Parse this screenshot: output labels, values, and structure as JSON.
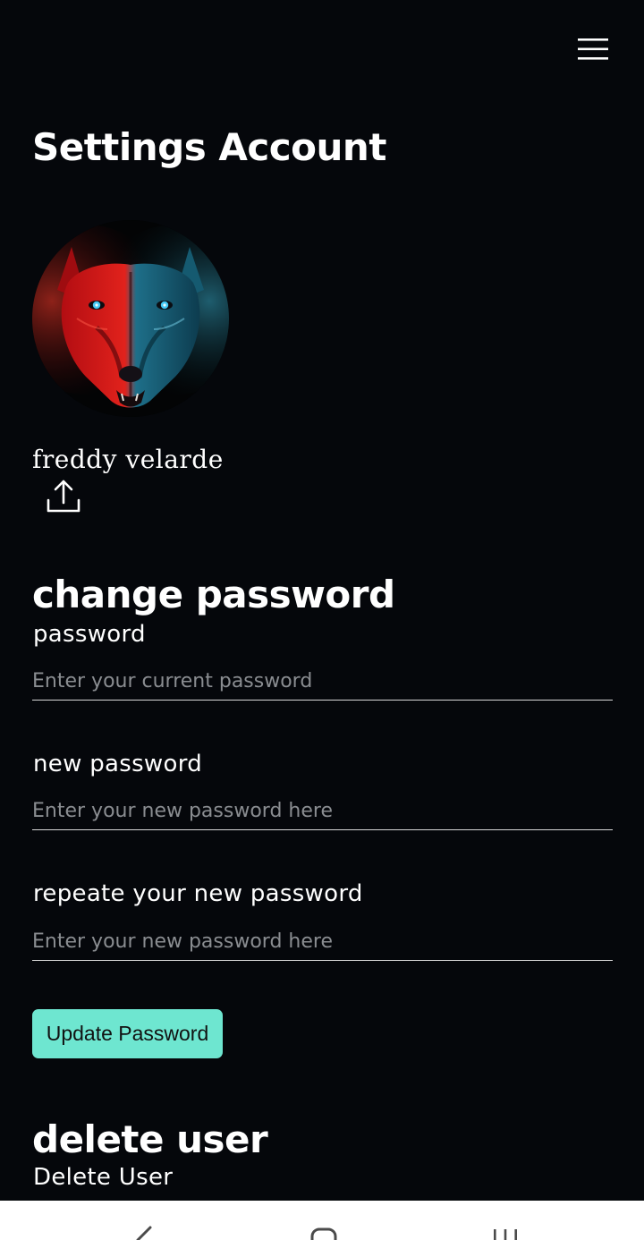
{
  "header": {
    "menu_icon": "hamburger-menu-icon"
  },
  "page": {
    "title": "Settings Account"
  },
  "profile": {
    "avatar_icon": "wolf-avatar",
    "username": "freddy velarde",
    "upload_icon": "upload-icon"
  },
  "change_password": {
    "heading": "change password",
    "fields": [
      {
        "label": "password",
        "placeholder": "Enter your current password",
        "value": ""
      },
      {
        "label": "new password",
        "placeholder": "Enter your new password here",
        "value": ""
      },
      {
        "label": "repeate your new password",
        "placeholder": "Enter your new password here",
        "value": ""
      }
    ],
    "submit_label": "Update Password"
  },
  "delete_user": {
    "heading": "delete user",
    "link_label": "Delete User"
  },
  "nav_bar": {
    "buttons": [
      "back-icon",
      "home-icon",
      "recent-apps-icon"
    ]
  },
  "colors": {
    "background": "#05070b",
    "text": "#ffffff",
    "placeholder": "#8a8d91",
    "accent": "#6ee6d0",
    "divider": "#d8d8d8",
    "nav_bar": "#ffffff"
  }
}
